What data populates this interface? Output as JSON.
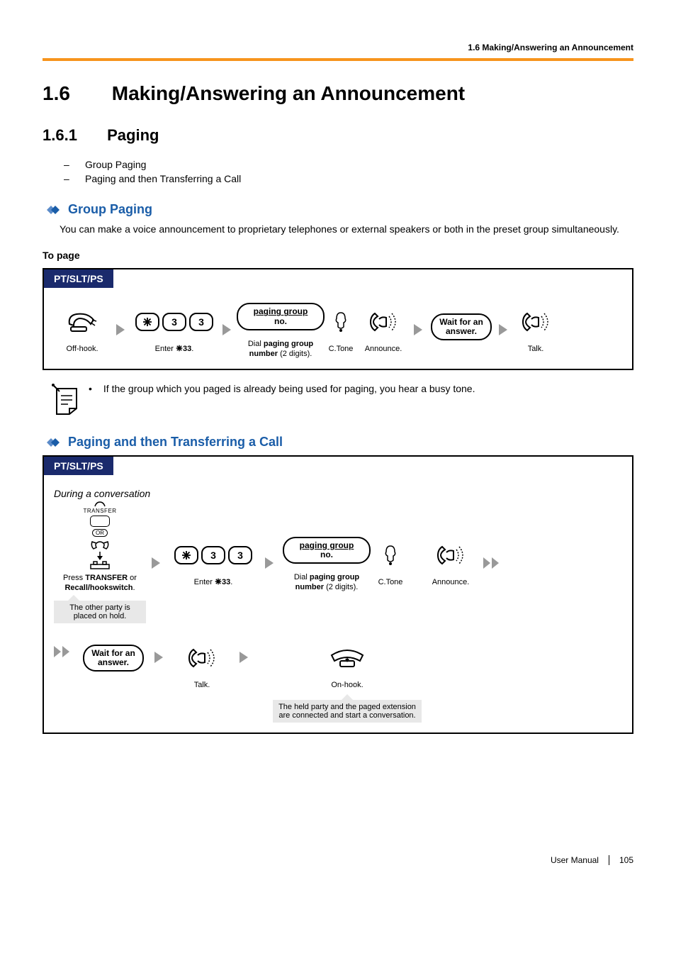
{
  "header": {
    "breadcrumb": "1.6 Making/Answering an Announcement"
  },
  "title": {
    "number": "1.6",
    "text": "Making/Answering an Announcement"
  },
  "subsection": {
    "number": "1.6.1",
    "text": "Paging"
  },
  "toc": {
    "item1": "Group Paging",
    "item2": "Paging and then Transferring a Call"
  },
  "group_paging": {
    "heading": "Group Paging",
    "intro": "You can make a voice announcement to proprietary telephones or external speakers or both in the preset group simultaneously.",
    "proc_title": "To page",
    "tab": "PT/SLT/PS",
    "steps": {
      "offhook": "Off-hook.",
      "enter33_prefix": "Enter ",
      "enter33_code": "33",
      "enter33_suffix": ".",
      "paging_pill_l1": "paging group",
      "paging_pill_l2": "no.",
      "dial_prefix": "Dial ",
      "dial_bold": "paging group number",
      "dial_suffix": " (2 digits).",
      "ctone": "C.Tone",
      "announce": "Announce.",
      "wait_l1": "Wait for an",
      "wait_l2": "answer.",
      "talk": "Talk."
    },
    "note": "If the group which you paged is already being used for paging, you hear a busy tone."
  },
  "paging_transfer": {
    "heading": "Paging and then Transferring a Call",
    "tab": "PT/SLT/PS",
    "context": "During a conversation",
    "transfer_label": "TRANSFER",
    "or_label": "OR",
    "press_prefix": "Press ",
    "press_bold1": "TRANSFER",
    "press_mid": " or ",
    "press_bold2": "Recall/hookswitch",
    "press_suffix": ".",
    "callout_hold": "The other party is placed on hold.",
    "enter33_prefix": "Enter ",
    "enter33_code": "33",
    "enter33_suffix": ".",
    "paging_pill_l1": "paging group",
    "paging_pill_l2": "no.",
    "dial_prefix": "Dial ",
    "dial_bold": "paging group number",
    "dial_suffix": " (2 digits).",
    "ctone": "C.Tone",
    "announce": "Announce.",
    "wait_l1": "Wait for an",
    "wait_l2": "answer.",
    "talk": "Talk.",
    "onhook": "On-hook.",
    "callout_end_l1": "The held party and the paged extension",
    "callout_end_l2": "are connected and start a conversation."
  },
  "footer": {
    "label": "User Manual",
    "page": "105"
  }
}
